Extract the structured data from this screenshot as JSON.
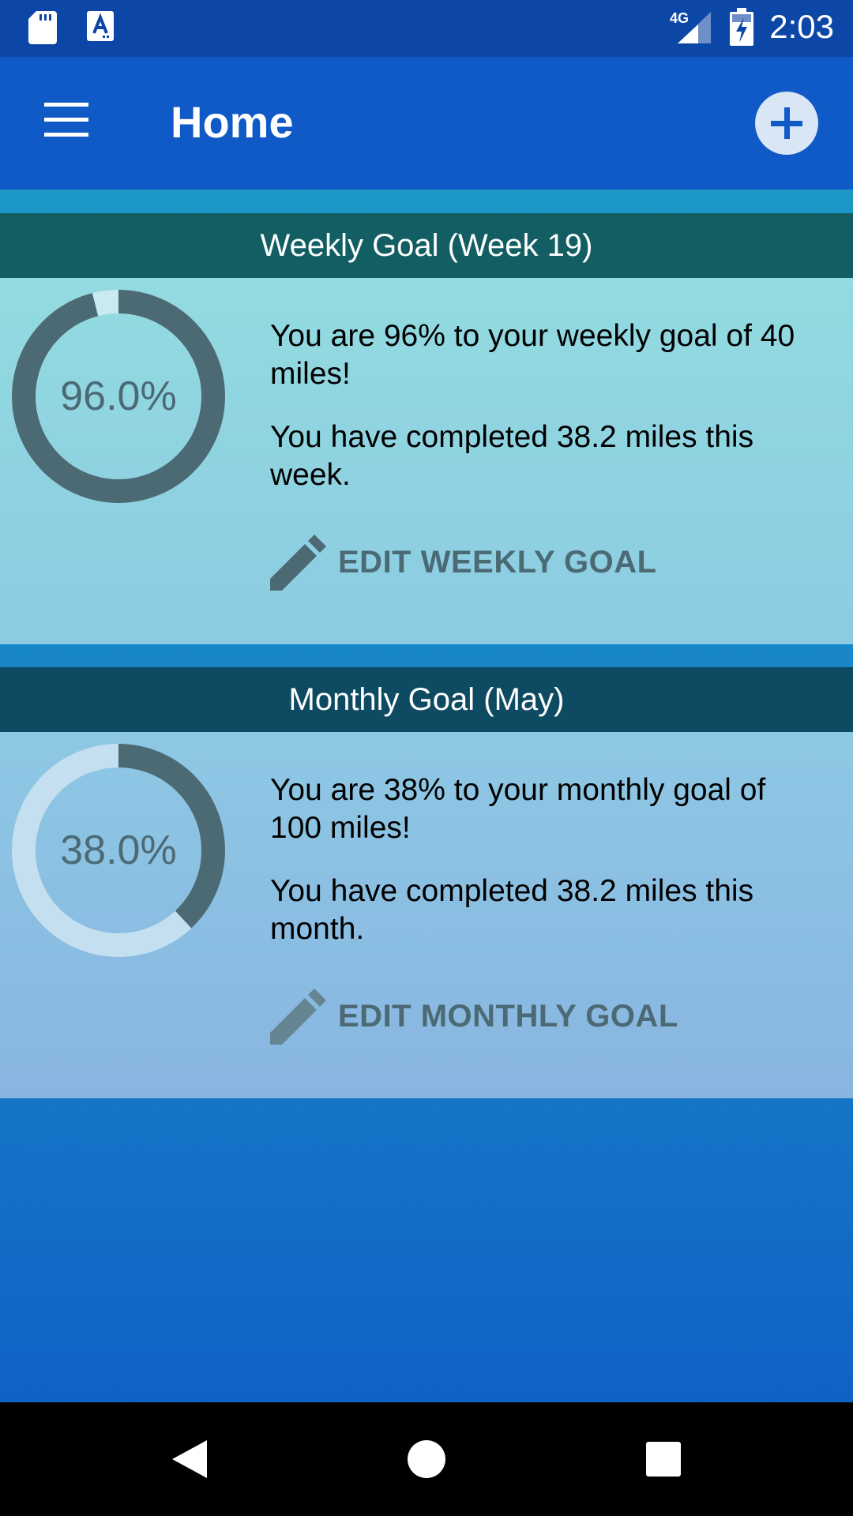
{
  "status_bar": {
    "time": "2:03",
    "network": "4G",
    "icons": [
      "sd-card-icon",
      "text-a-icon",
      "signal-icon",
      "battery-charging-icon"
    ]
  },
  "app_bar": {
    "title": "Home",
    "menu_icon": "hamburger-menu-icon",
    "add_icon": "add-icon"
  },
  "weekly": {
    "header": "Weekly Goal (Week 19)",
    "percent_label": "96.0%",
    "progress_fraction": 0.96,
    "line1": "You are 96% to your weekly goal of 40 miles!",
    "line2": "You have completed 38.2 miles this week.",
    "edit_label": "EDIT WEEKLY GOAL"
  },
  "monthly": {
    "header": "Monthly Goal (May)",
    "percent_label": "38.0%",
    "progress_fraction": 0.38,
    "line1": "You are 38% to your monthly goal of 100 miles!",
    "line2": "You have completed 38.2 miles this month.",
    "edit_label": "EDIT MONTHLY GOAL"
  },
  "nav_bar": {
    "back_icon": "back-icon",
    "home_icon": "home-icon",
    "recents_icon": "recents-icon"
  },
  "colors": {
    "app_bar": "#0f5ac6",
    "status_bar": "#0c47a8",
    "weekly_header": "#135e62",
    "monthly_header": "#0e4b62",
    "ring_progress": "#4c6a74"
  }
}
